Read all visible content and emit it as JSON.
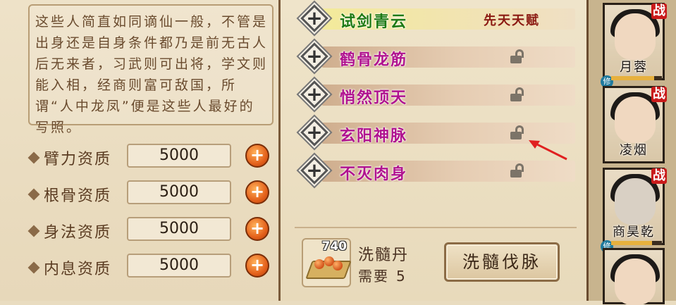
{
  "description": "这些人简直如同谪仙一般，不管是出身还是自身条件都乃是前无古人后无来者，习武则可出将，学文则能入相，经商则富可敌国，所谓“人中龙凤”便是这些人最好的写照。",
  "attributes": [
    {
      "label": "臂力资质",
      "value": "5000"
    },
    {
      "label": "根骨资质",
      "value": "5000"
    },
    {
      "label": "身法资质",
      "value": "5000"
    },
    {
      "label": "内息资质",
      "value": "5000"
    }
  ],
  "skills": [
    {
      "name": "试剑青云",
      "tag": "先天天赋",
      "locked": false
    },
    {
      "name": "鹤骨龙筋",
      "tag": "",
      "locked": true
    },
    {
      "name": "悄然顶天",
      "tag": "",
      "locked": true
    },
    {
      "name": "玄阳神脉",
      "tag": "",
      "locked": true
    },
    {
      "name": "不灭肉身",
      "tag": "",
      "locked": true
    }
  ],
  "item": {
    "count": "740",
    "name": "洗髓丹",
    "need_label": "需要",
    "need_value": "5"
  },
  "refine_button": "洗髓伐脉",
  "characters": [
    {
      "name": "月蓉",
      "battle": "战",
      "xiu": "修",
      "hp": 0.85
    },
    {
      "name": "凌烟",
      "battle": "战",
      "xiu": "",
      "hp": 0
    },
    {
      "name": "商昊乾",
      "battle": "战",
      "xiu": "修",
      "hp": 0.8
    },
    {
      "name": "",
      "battle": "",
      "xiu": "",
      "hp": 0
    }
  ],
  "colors": {
    "skill_name": "#b0128f",
    "skill_name_first": "#1e7a14",
    "tag": "#8b1a12",
    "arrow": "#e02020"
  }
}
